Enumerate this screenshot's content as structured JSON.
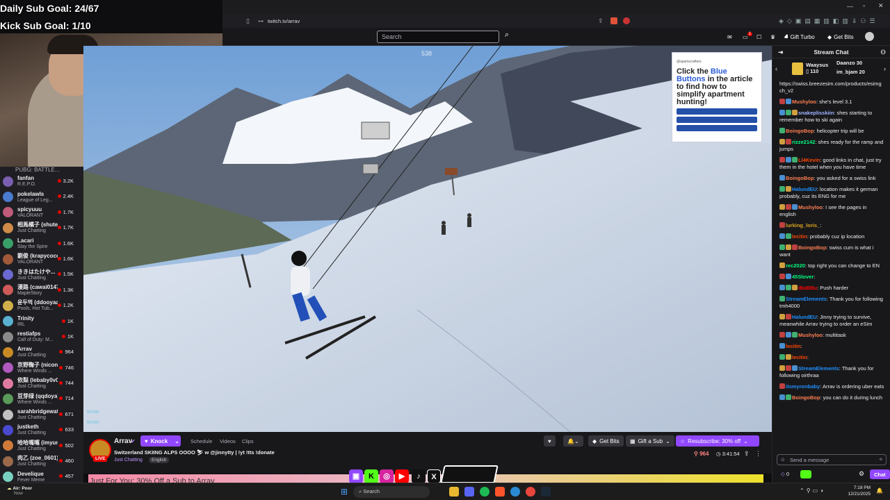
{
  "goals": {
    "daily": "Daily Sub Goal: 24/67",
    "kick": "Kick Sub Goal: 1/10"
  },
  "browser": {
    "url": "twitch.tv/arrav"
  },
  "header": {
    "search_placeholder": "Search",
    "gift_turbo": "Gift Turbo",
    "get_bits": "Get Bits",
    "notif_count": "1"
  },
  "sidebar": {
    "top_label": "PUBG: BATTLE...",
    "items": [
      {
        "name": "fanfan",
        "game": "R.E.P.O.",
        "viewers": "3.2K",
        "color": "#7a5fb0"
      },
      {
        "name": "pokelawls",
        "game": "League of Leg...",
        "viewers": "2.4K",
        "color": "#4a7bd0"
      },
      {
        "name": "spicyuuu",
        "game": "VALORANT",
        "viewers": "1.7K",
        "color": "#c25a7a"
      },
      {
        "name": "相馬橘子 (shute...",
        "game": "Just Chatting",
        "viewers": "1.7K",
        "color": "#d08a4a"
      },
      {
        "name": "Lacari",
        "game": "Slay the Spire",
        "viewers": "1.6K",
        "color": "#3aa06a"
      },
      {
        "name": "劉俊 (krapycoco)",
        "game": "VALORANT",
        "viewers": "1.6K",
        "color": "#a05a3a"
      },
      {
        "name": "ききはたけや...",
        "game": "Just Chatting",
        "viewers": "1.5K",
        "color": "#6a6ad0"
      },
      {
        "name": "漫路 (cawai0147)",
        "game": "MapleStory",
        "viewers": "1.3K",
        "color": "#d05a5a"
      },
      {
        "name": "윤두먹 (ddooyaa)",
        "game": "Pools, Hot Tub...",
        "viewers": "1.2K",
        "color": "#d0b04a"
      },
      {
        "name": "Trinity",
        "game": "IRL",
        "viewers": "1K",
        "color": "#5ab0d0"
      },
      {
        "name": "restiafps",
        "game": "Call of Duty: M...",
        "viewers": "1K",
        "color": "#8a8a8a"
      },
      {
        "name": "Arrav",
        "game": "Just Chatting",
        "viewers": "964",
        "color": "#c98a24"
      },
      {
        "name": "京野鞠子 (niconi...",
        "game": "Where Winds ...",
        "viewers": "746",
        "color": "#b05ac0"
      },
      {
        "name": "依梨 (lebaby0v0)",
        "game": "Just Chatting",
        "viewers": "744",
        "color": "#e07aa0"
      },
      {
        "name": "豆芽绿 (qqdoya)",
        "game": "Where Winds ...",
        "viewers": "714",
        "color": "#5a9a5a"
      },
      {
        "name": "sarahbridgewat...",
        "game": "Just Chatting",
        "viewers": "671",
        "color": "#c0c0c0"
      },
      {
        "name": "justketh",
        "game": "Just Chatting",
        "viewers": "633",
        "color": "#4a4ad0"
      },
      {
        "name": "哈哈嘴嘴 (imyun...",
        "game": "Just Chatting",
        "viewers": "502",
        "color": "#d07a3a"
      },
      {
        "name": "肉乙 (zoe_0601)",
        "game": "Just Chatting",
        "viewers": "460",
        "color": "#9a6a4a"
      },
      {
        "name": "Develique",
        "game": "Fever Meme",
        "viewers": "457",
        "color": "#7ad0c0"
      }
    ]
  },
  "video": {
    "overlay_num": "538",
    "chat_ghost_1": "lecitin",
    "chat_ghost_2": "lecitin"
  },
  "ad": {
    "brand": "@apartscrafters",
    "title_pre": "Click the ",
    "title_hl": "Blue Buttons",
    "title_post": " in the article to find how to simplify apartment hunting!"
  },
  "stream": {
    "channel": "Arrav",
    "knock": "Knock",
    "tabs": [
      "Schedule",
      "Videos",
      "Clips"
    ],
    "title": "Switzerland SKIING ALPS OOOO ⛷ w @jinnytty | !yt !tts !donate",
    "category": "Just Chatting",
    "language": "English",
    "live": "LIVE",
    "viewers": "964",
    "uptime": "3:41:54",
    "get_bits": "Get Bits",
    "gift_sub": "Gift a Sub",
    "resub": "Resubscribe: 30% off"
  },
  "promo": {
    "text": "Just For You: 30% Off a Sub to Arrav"
  },
  "chat": {
    "title": "Stream Chat",
    "hype": [
      {
        "name": "Waaysus",
        "amount": "110"
      },
      {
        "name": "Daanzo",
        "amount": "30"
      },
      {
        "name": "im_bjam",
        "amount": "20"
      }
    ],
    "messages": [
      {
        "user": "",
        "color": "#a970ff",
        "text": "https://swiss.breezesim.com/products/esimg ch_v2"
      },
      {
        "user": "Mushyloo",
        "color": "#ff7f50",
        "text": ": she's level 3.1"
      },
      {
        "user": "snakeplisskiin",
        "color": "#9fb6ff",
        "text": ": shes starting to remember how to ski again"
      },
      {
        "user": "BoingoBop",
        "color": "#ff7f50",
        "text": ": helicopter trip will be"
      },
      {
        "user": "rizze2142",
        "color": "#00ff7f",
        "text": ": shes ready for the ramp and jumps"
      },
      {
        "user": "Ll4Kevin",
        "color": "#ff4500",
        "text": ": good links in chat, just try them in the hotel when you have time"
      },
      {
        "user": "BoingoBop",
        "color": "#ff7f50",
        "text": ": you asked for a swiss link"
      },
      {
        "user": "HalundEU",
        "color": "#1e90ff",
        "text": ": location makes it german probably, cuz its ENG for me"
      },
      {
        "user": "Mushyloo",
        "color": "#ff7f50",
        "text": ": I see the pages in english"
      },
      {
        "user": "lurking_loris_",
        "color": "#daa520",
        "text": ":"
      },
      {
        "user": "lecitin",
        "color": "#ff4500",
        "text": ": probably cuz ip location"
      },
      {
        "user": "BoingoBop",
        "color": "#ff7f50",
        "text": ": swiss cum is what i want"
      },
      {
        "user": "rec2020",
        "color": "#00ff7f",
        "text": ": top right you can change to EN"
      },
      {
        "user": "45Slover",
        "color": "#00ff7f",
        "text": ":"
      },
      {
        "user": "iBaBBu",
        "color": "#ff0000",
        "text": ": Push harder"
      },
      {
        "user": "StreamElements",
        "color": "#1e90ff",
        "text": ": Thank you for following tmh4000"
      },
      {
        "user": "HalundEU",
        "color": "#1e90ff",
        "text": ": Jinny trying to survive, meanwhile Arrav trying to order an eSim"
      },
      {
        "user": "Mushyloo",
        "color": "#ff7f50",
        "text": ": multitask"
      },
      {
        "user": "lecitin",
        "color": "#ff4500",
        "text": ":"
      },
      {
        "user": "lecitin",
        "color": "#ff4500",
        "text": ":"
      },
      {
        "user": "StreamElements",
        "color": "#1e90ff",
        "text": ": Thank you for following oirthraa"
      },
      {
        "user": "itsmyronbaby",
        "color": "#1e90ff",
        "text": ": Arrav is ordering uber eats"
      },
      {
        "user": "BoingoBop",
        "color": "#ff7f50",
        "text": ": you can do it during lunch"
      }
    ],
    "input_placeholder": "Send a message",
    "points": "0",
    "chat_button": "Chat"
  },
  "taskbar": {
    "weather_title": "Air: Poor",
    "weather_sub": "Now",
    "search": "Search",
    "time": "7:18 PM",
    "date": "12/21/2025"
  },
  "colors": {
    "twitch_purple": "#9147ff",
    "live_red": "#eb0400",
    "bg": "#0e0e10"
  }
}
